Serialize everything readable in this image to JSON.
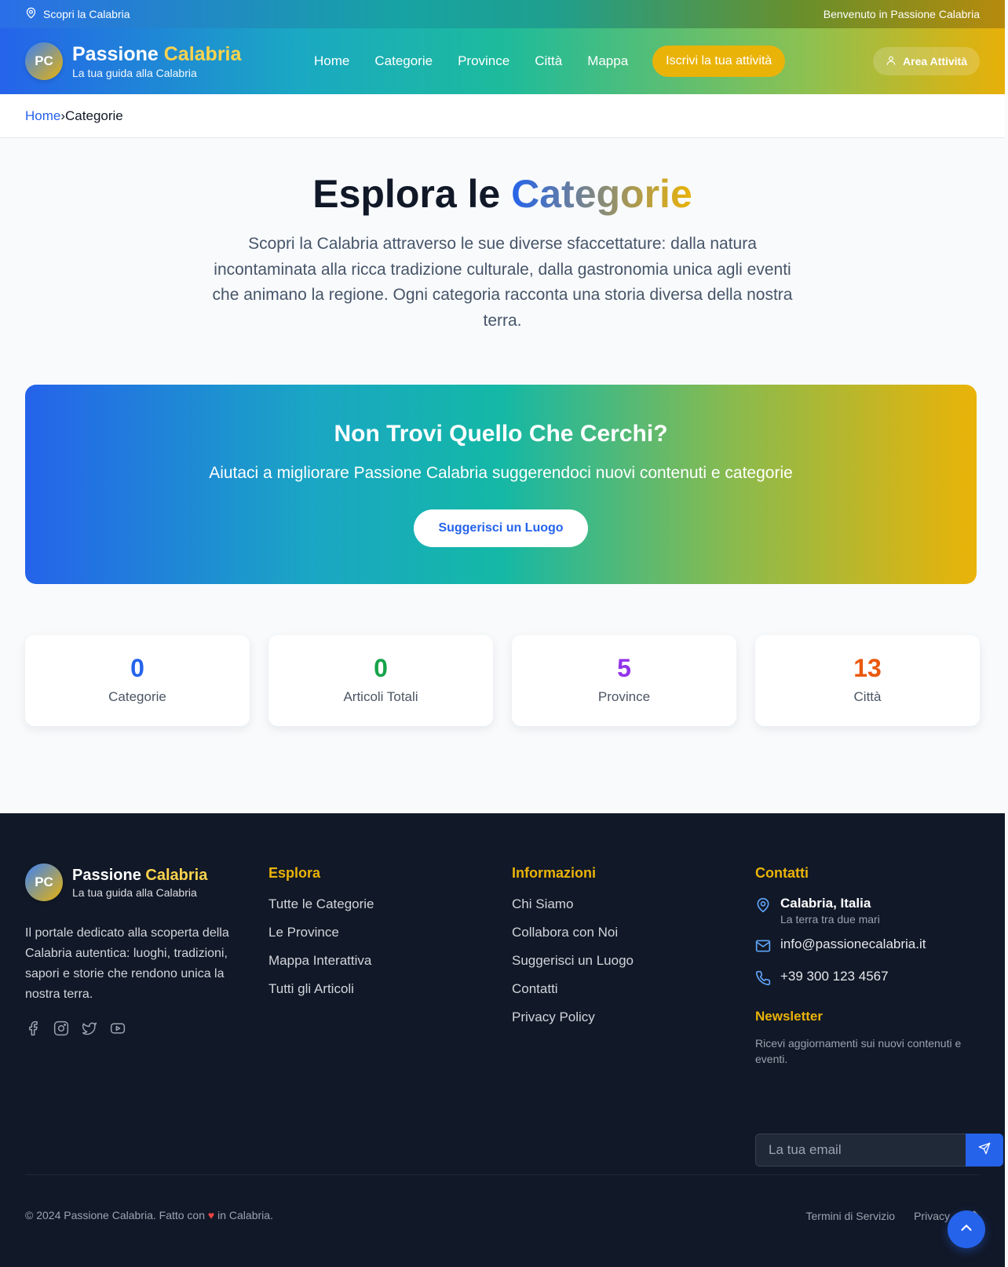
{
  "topbar": {
    "location_label": "Scopri la Calabria",
    "welcome": "Benvenuto in Passione Calabria"
  },
  "brand": {
    "initials": "PC",
    "name_part1": "Passione",
    "name_part2": "Calabria",
    "tagline": "La tua guida alla Calabria"
  },
  "nav": {
    "items": [
      "Home",
      "Categorie",
      "Province",
      "Città",
      "Mappa"
    ],
    "cta": "Iscrivi la tua attività",
    "area": "Area Attività"
  },
  "breadcrumb": {
    "home": "Home",
    "separator": "›",
    "current": "Categorie"
  },
  "hero": {
    "title_plain": "Esplora le",
    "title_accent": "Categorie",
    "text": "Scopri la Calabria attraverso le sue diverse sfaccettature: dalla natura incontaminata alla ricca tradizione culturale, dalla gastronomia unica agli eventi che animano la regione. Ogni categoria racconta una storia diversa della nostra terra."
  },
  "banner": {
    "title": "Non Trovi Quello Che Cerchi?",
    "text": "Aiutaci a migliorare Passione Calabria suggerendoci nuovi contenuti e categorie",
    "button": "Suggerisci un Luogo"
  },
  "stats": [
    {
      "value": "0",
      "label": "Categorie",
      "color": "#2563eb"
    },
    {
      "value": "0",
      "label": "Articoli Totali",
      "color": "#16a34a"
    },
    {
      "value": "5",
      "label": "Province",
      "color": "#9333ea"
    },
    {
      "value": "13",
      "label": "Città",
      "color": "#ea580c"
    }
  ],
  "footer": {
    "description": "Il portale dedicato alla scoperta della Calabria autentica: luoghi, tradizioni, sapori e storie che rendono unica la nostra terra.",
    "social_icons": [
      "facebook-icon",
      "instagram-icon",
      "twitter-icon",
      "youtube-icon"
    ],
    "explore": {
      "title": "Esplora",
      "links": [
        "Tutte le Categorie",
        "Le Province",
        "Mappa Interattiva",
        "Tutti gli Articoli"
      ]
    },
    "info": {
      "title": "Informazioni",
      "links": [
        "Chi Siamo",
        "Collabora con Noi",
        "Suggerisci un Luogo",
        "Contatti",
        "Privacy Policy"
      ]
    },
    "contacts": {
      "title": "Contatti",
      "place": "Calabria, Italia",
      "place_sub": "La terra tra due mari",
      "email": "info@passionecalabria.it",
      "phone": "+39 300 123 4567"
    },
    "newsletter": {
      "title": "Newsletter",
      "text": "Ricevi aggiornamenti sui nuovi contenuti e eventi.",
      "placeholder": "La tua email"
    },
    "copyright_pre": "© 2024 Passione Calabria. Fatto con",
    "copyright_post": "in Calabria.",
    "bottom_links": [
      "Termini di Servizio",
      "Privacy"
    ]
  },
  "colors": {
    "primary": "#2563eb",
    "accent": "#eab308",
    "footer_bg": "#111827"
  }
}
